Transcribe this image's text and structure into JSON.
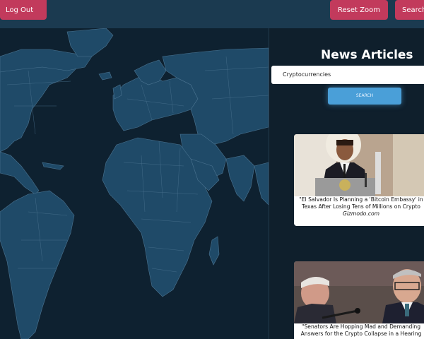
{
  "topbar": {
    "logout_label": "Log Out",
    "reset_zoom_label": "Reset Zoom",
    "search_label": "Search"
  },
  "news": {
    "title": "News Articles",
    "query_value": "Cryptocurrencies",
    "search_button_label": "SEARCH",
    "articles": [
      {
        "headline": "\"El Salvador Is Planning a 'Bitcoin Embassy' in Texas After Losing Tens of Millions on Crypto",
        "source": "Gizmodo.com"
      },
      {
        "headline": "\"Senators Are Hopping Mad and Demanding Answers for the Crypto Collapse in a Hearing",
        "source": ""
      }
    ]
  },
  "colors": {
    "topbar": "#1b3a50",
    "accent_red": "#c23a5c",
    "search_blue": "#4a9fd8",
    "map_ocean": "#0e2130",
    "map_land": "#1f4a68",
    "map_borders": "#4b7491"
  }
}
